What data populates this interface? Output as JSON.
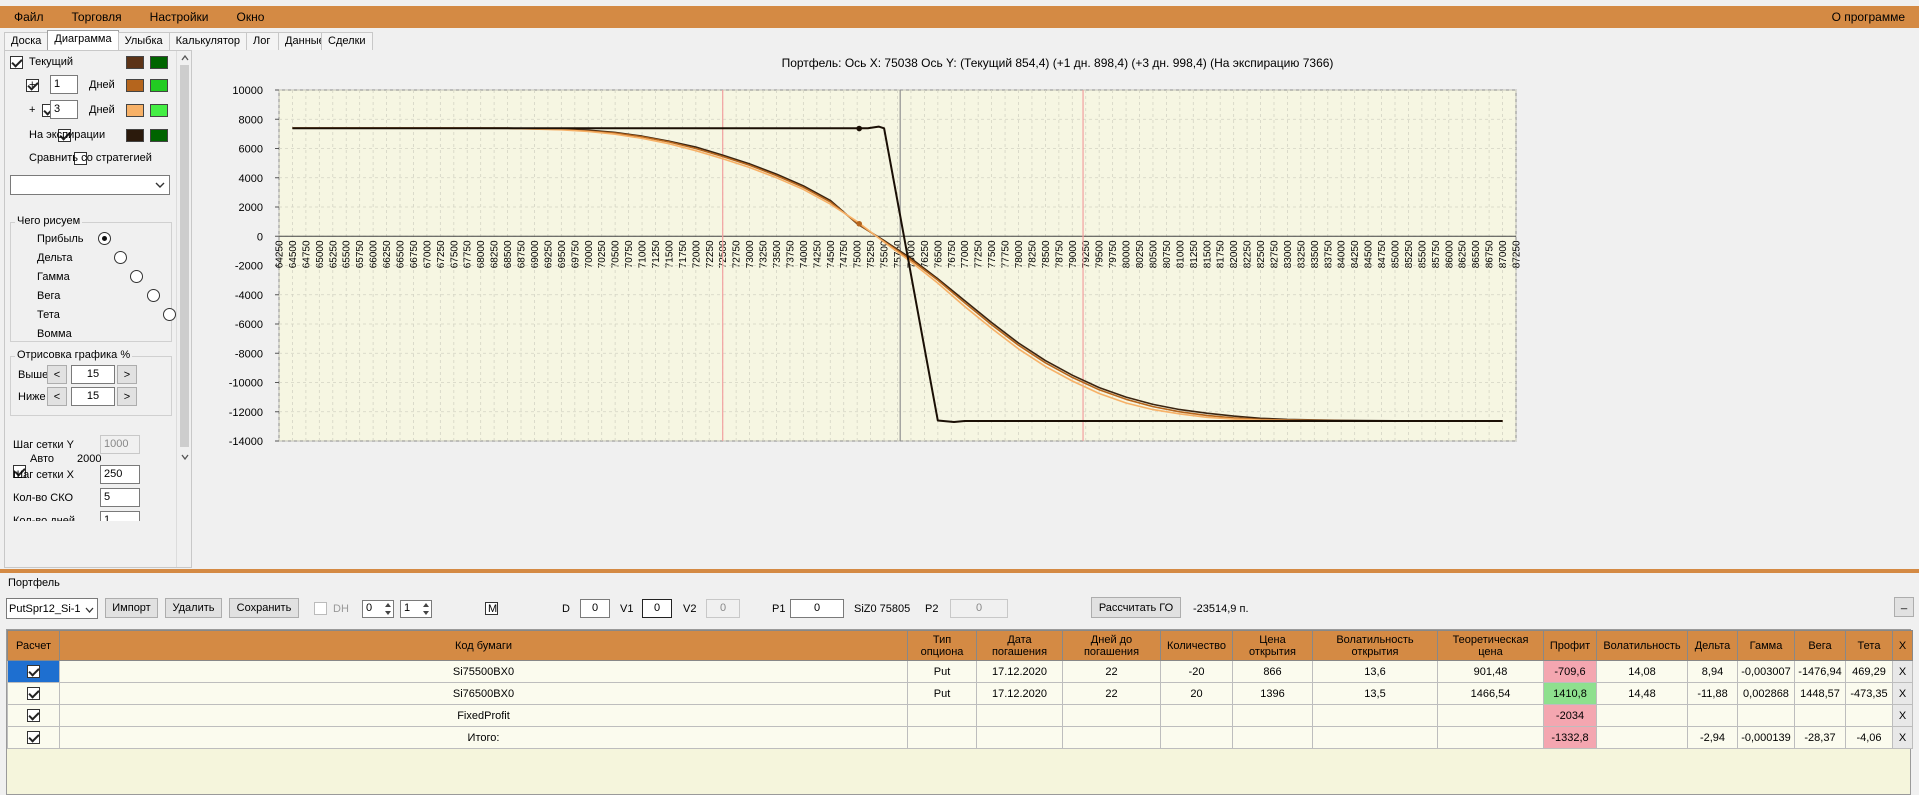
{
  "menu": [
    "Файл",
    "Торговля",
    "Настройки",
    "Окно"
  ],
  "menu_right": "О программе",
  "tabs": [
    "Доска",
    "Диаграмма",
    "Улыбка",
    "Калькулятор",
    "Лог",
    "Данные",
    "Сделки"
  ],
  "active_tab": "Диаграмма",
  "left": {
    "current_label": "Текущий",
    "plus_sign": "+",
    "days_1_value": "1",
    "days_3_value": "3",
    "days_label": "Дней",
    "expiration_label": "На экспирации",
    "compare_label": "Сравнить со стратегией",
    "compare_select": "",
    "what_draw_title": "Чего рисуем",
    "radios": [
      "Прибыль",
      "Дельта",
      "Гамма",
      "Вега",
      "Тета",
      "Вомма"
    ],
    "selected_radio": "Прибыль",
    "render_title": "Отрисовка графика %",
    "above_label": "Выше",
    "above_value": "15",
    "below_label": "Ниже",
    "below_value": "15",
    "prev_glyph": "<",
    "next_glyph": ">",
    "grid_y_label": "Шаг сетки Y",
    "grid_y_value": "1000",
    "auto_label": "Авто",
    "auto_value": "2000",
    "grid_x_label": "Шаг сетки X",
    "grid_x_value": "250",
    "sko_label": "Кол-во СКО",
    "sko_value": "5",
    "days_count_label": "Кол-во дней",
    "days_count_value": "1",
    "colors": {
      "current": [
        "#5c3317",
        "#006400"
      ],
      "plus1": [
        "#b5651d",
        "#22cc22"
      ],
      "plus3": [
        "#f7b167",
        "#44ee44"
      ],
      "expiration": [
        "#2b1a0c",
        "#006400"
      ]
    }
  },
  "chart_header": "Портфель:  Ось X:  75038  Ось Y:   (Текущий 854,4)   (+1 дн. 898,4)   (+3 дн. 998,4)   (На экспирацию 7366)",
  "chart_data": {
    "type": "line",
    "title": "Портфель:  Ось X:  75038  Ось Y:   (Текущий 854,4)   (+1 дн. 898,4)   (+3 дн. 998,4)   (На экспирацию 7366)",
    "xlim": [
      64250,
      87250
    ],
    "ylim": [
      -14000,
      10000
    ],
    "x_tick_step": 250,
    "y_ticks": [
      10000,
      8000,
      6000,
      4000,
      2000,
      0,
      -2000,
      -4000,
      -6000,
      -8000,
      -10000,
      -12000,
      -14000
    ],
    "grid": true,
    "vertical_markers": [
      {
        "x": 72500,
        "color": "#f2a0a0"
      },
      {
        "x": 75800,
        "color": "#909090"
      },
      {
        "x": 79200,
        "color": "#f2a0a0"
      }
    ],
    "series": [
      {
        "color": "#3a2410",
        "x": [
          64500,
          65500,
          66500,
          67500,
          68500,
          69500,
          70000,
          70500,
          71000,
          71500,
          72000,
          72500,
          73000,
          73500,
          74000,
          74500,
          75000,
          75500,
          76000,
          76500,
          77000,
          77500,
          78000,
          78500,
          79000,
          79500,
          80000,
          80500,
          81000,
          81500,
          82000,
          82500,
          83000,
          84000,
          85000,
          86000,
          87000
        ],
        "y": [
          7400,
          7400,
          7400,
          7400,
          7390,
          7320,
          7250,
          7100,
          6850,
          6500,
          6100,
          5550,
          4950,
          4250,
          3450,
          2450,
          850,
          -300,
          -1500,
          -2900,
          -4400,
          -5900,
          -7300,
          -8500,
          -9500,
          -10350,
          -11000,
          -11500,
          -11850,
          -12100,
          -12300,
          -12450,
          -12520,
          -12590,
          -12620,
          -12630,
          -12630
        ]
      },
      {
        "color": "#b5651d",
        "x": [
          64500,
          65500,
          66500,
          67500,
          68500,
          69500,
          70000,
          70500,
          71000,
          71500,
          72000,
          72500,
          73000,
          73500,
          74000,
          74500,
          75000,
          75500,
          76000,
          76500,
          77000,
          77500,
          78000,
          78500,
          79000,
          79500,
          80000,
          80500,
          81000,
          81500,
          82000,
          82500,
          83000,
          84000,
          85000,
          86000,
          87000
        ],
        "y": [
          7400,
          7400,
          7400,
          7400,
          7385,
          7300,
          7200,
          7050,
          6800,
          6450,
          6000,
          5450,
          4850,
          4150,
          3350,
          2350,
          900,
          -350,
          -1600,
          -3000,
          -4550,
          -6050,
          -7450,
          -8650,
          -9650,
          -10500,
          -11150,
          -11650,
          -12000,
          -12250,
          -12420,
          -12520,
          -12570,
          -12610,
          -12630,
          -12630,
          -12630
        ]
      },
      {
        "color": "#f7b167",
        "x": [
          64500,
          65500,
          66500,
          67500,
          68500,
          69500,
          70000,
          70500,
          71000,
          71500,
          72000,
          72500,
          73000,
          73500,
          74000,
          74500,
          75000,
          75500,
          76000,
          76500,
          77000,
          77500,
          78000,
          78500,
          79000,
          79500,
          80000,
          80500,
          81000,
          81500,
          82000,
          82500,
          83000,
          84000,
          85000,
          86000,
          87000
        ],
        "y": [
          7400,
          7400,
          7400,
          7400,
          7380,
          7280,
          7160,
          6980,
          6700,
          6330,
          5850,
          5300,
          4700,
          4000,
          3200,
          2200,
          1000,
          -400,
          -1750,
          -3200,
          -4800,
          -6300,
          -7700,
          -8900,
          -9900,
          -10750,
          -11400,
          -11850,
          -12150,
          -12380,
          -12500,
          -12570,
          -12600,
          -12620,
          -12630,
          -12630,
          -12630
        ]
      },
      {
        "color": "#1a0f05",
        "x": [
          64500,
          74500,
          75000,
          75200,
          75400,
          75500,
          76500,
          76800,
          77000,
          87000
        ],
        "y": [
          7380,
          7380,
          7380,
          7380,
          7500,
          7380,
          -12600,
          -12700,
          -12630,
          -12630
        ]
      }
    ],
    "points": [
      {
        "x": 75038,
        "y": 7366,
        "color": "#1a0f05"
      },
      {
        "x": 75038,
        "y": 854.4,
        "color": "#b5651d"
      }
    ]
  },
  "portfolio": {
    "label": "Портфель",
    "select_value": "PutSpr12_Si-1",
    "import_label": "Импорт",
    "delete_label": "Удалить",
    "save_label": "Сохранить",
    "dh_label": "DH",
    "spin1": "0",
    "spin2": "1",
    "m_label": "M",
    "d_label": "D",
    "d_value": "0",
    "v1_label": "V1",
    "v1_value": "0",
    "v2_label": "V2",
    "v2_value": "0",
    "p1_label": "P1",
    "p1_value": "0",
    "instrument_price": "SiZ0 75805",
    "p2_label": "P2",
    "p2_value": "0",
    "calc_go_label": "Рассчитать ГО",
    "go_value": "-23514,9 п.",
    "minimize_label": "_"
  },
  "table": {
    "headers": [
      "Расчет",
      "Код бумаги",
      "Тип опциона",
      "Дата погашения",
      "Дней до погашения",
      "Количество",
      "Цена открытия",
      "Волатильность открытия",
      "Теоретическая цена",
      "Профит",
      "Волатильность",
      "Дельта",
      "Гамма",
      "Вега",
      "Тета",
      "X"
    ],
    "rows": [
      [
        "",
        "Si75500BX0",
        "Put",
        "17.12.2020",
        "22",
        "-20",
        "866",
        "13,6",
        "901,48",
        "-709,6",
        "14,08",
        "8,94",
        "-0,003007",
        "-1476,94",
        "469,29",
        "X"
      ],
      [
        "",
        "Si76500BX0",
        "Put",
        "17.12.2020",
        "22",
        "20",
        "1396",
        "13,5",
        "1466,54",
        "1410,8",
        "14,48",
        "-11,88",
        "0,002868",
        "1448,57",
        "-473,35",
        "X"
      ],
      [
        "",
        "FixedProfit",
        "",
        "",
        "",
        "",
        "",
        "",
        "",
        "-2034",
        "",
        "",
        "",
        "",
        "",
        "X"
      ],
      [
        "",
        "Итого:",
        "",
        "",
        "",
        "",
        "",
        "",
        "",
        "-1332,8",
        "",
        "-2,94",
        "-0,000139",
        "-28,37",
        "-4,06",
        "X"
      ]
    ]
  }
}
